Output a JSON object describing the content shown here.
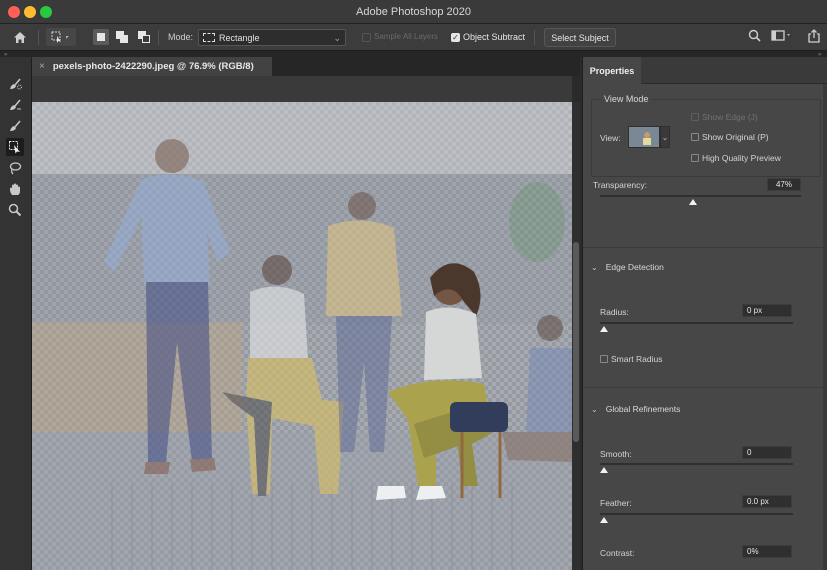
{
  "window": {
    "title": "Adobe Photoshop 2020"
  },
  "options_bar": {
    "mode_label": "Mode:",
    "mode_value": "Rectangle",
    "sample_all_layers_label": "Sample All Layers",
    "sample_all_layers_checked": false,
    "object_subtract_label": "Object Subtract",
    "object_subtract_checked": true,
    "select_subject_label": "Select Subject",
    "icons": [
      "home-icon",
      "quick-selection-preset-icon",
      "new-selection-icon",
      "add-to-selection-icon",
      "subtract-from-selection-icon",
      "search-icon",
      "workspace-icon",
      "share-icon"
    ]
  },
  "document": {
    "tab_title": "pexels-photo-2422290.jpeg @ 76.9% (RGB/8)",
    "close_glyph": "×"
  },
  "toolbar": {
    "tools": [
      "quick-selection-brush-icon",
      "refine-edge-brush-icon",
      "brush-icon",
      "object-selection-icon",
      "lasso-icon",
      "hand-icon",
      "zoom-icon"
    ],
    "active_tool": "object-selection-icon"
  },
  "properties": {
    "tab_label": "Properties",
    "view_mode": {
      "title": "View Mode",
      "view_label": "View:",
      "show_edge_label": "Show Edge (J)",
      "show_edge_checked": false,
      "show_original_label": "Show Original (P)",
      "show_original_checked": false,
      "high_quality_label": "High Quality Preview",
      "high_quality_checked": false
    },
    "transparency": {
      "label": "Transparency:",
      "value": "47%",
      "fraction": 0.47
    },
    "edge_detection": {
      "title": "Edge Detection",
      "radius_label": "Radius:",
      "radius_value": "0 px",
      "radius_fraction": 0.0,
      "smart_radius_label": "Smart Radius",
      "smart_radius_checked": false
    },
    "global_refinements": {
      "title": "Global Refinements",
      "smooth_label": "Smooth:",
      "smooth_value": "0",
      "smooth_fraction": 0.0,
      "feather_label": "Feather:",
      "feather_value": "0.0 px",
      "feather_fraction": 0.0,
      "contrast_label": "Contrast:",
      "contrast_value": "0%"
    }
  }
}
